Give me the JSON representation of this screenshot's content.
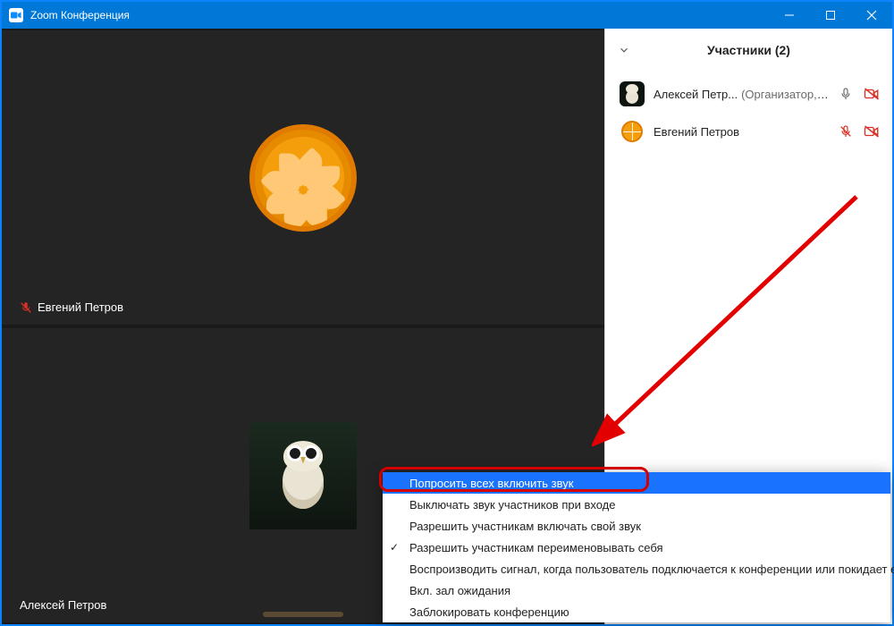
{
  "window": {
    "title": "Zoom Конференция"
  },
  "tiles": [
    {
      "name": "Евгений Петров",
      "muted": true
    },
    {
      "name": "Алексей Петров",
      "muted": false
    }
  ],
  "panel": {
    "title": "Участники (2)",
    "rows": [
      {
        "name": "Алексей Петр...",
        "role": "(Организатор, я)",
        "mic": "on",
        "cam": "off",
        "avatar": "owl"
      },
      {
        "name": "Евгений Петров",
        "role": "",
        "mic": "muted",
        "cam": "off",
        "avatar": "orange"
      }
    ]
  },
  "menu": {
    "items": [
      {
        "label": "Попросить всех включить звук",
        "highlight": true,
        "checked": false
      },
      {
        "label": "Выключать звук участников при входе",
        "highlight": false,
        "checked": false
      },
      {
        "label": "Разрешить участникам включать свой звук",
        "highlight": false,
        "checked": false
      },
      {
        "label": "Разрешить участникам переименовывать себя",
        "highlight": false,
        "checked": true
      },
      {
        "label": "Воспроизводить сигнал, когда пользователь подключается к конференции или покидает ее",
        "highlight": false,
        "checked": false
      },
      {
        "label": "Вкл. зал ожидания",
        "highlight": false,
        "checked": false
      },
      {
        "label": "Заблокировать конференцию",
        "highlight": false,
        "checked": false
      }
    ]
  }
}
